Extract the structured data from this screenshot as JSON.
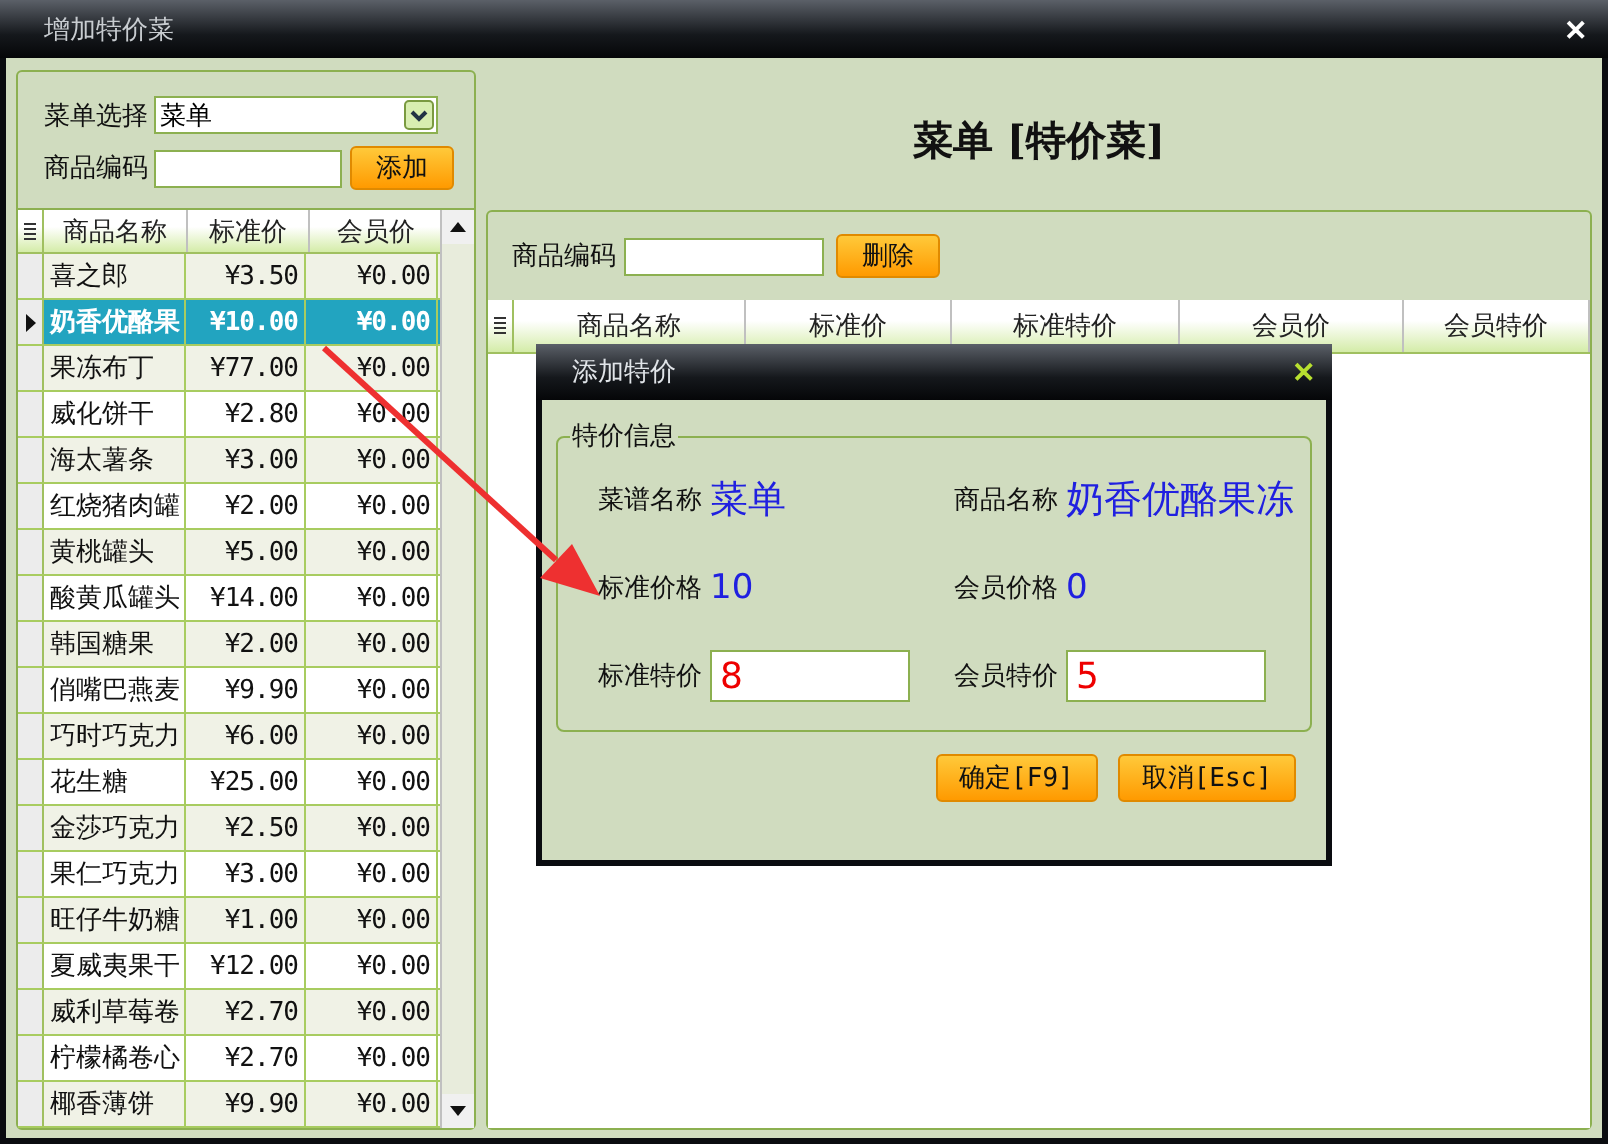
{
  "window": {
    "title": "增加特价菜",
    "close": "✕"
  },
  "left_panel": {
    "menu_select": {
      "label": "菜单选择",
      "value": "菜单"
    },
    "code_field": {
      "label": "商品编码"
    },
    "add_button": "添加"
  },
  "left_table": {
    "columns": [
      "商品名称",
      "标准价",
      "会员价"
    ],
    "rows": [
      {
        "name": "喜之郎",
        "price": "¥3.50",
        "member_price": "¥0.00",
        "selected": false
      },
      {
        "name": "奶香优酪果",
        "price": "¥10.00",
        "member_price": "¥0.00",
        "selected": true
      },
      {
        "name": "果冻布丁",
        "price": "¥77.00",
        "member_price": "¥0.00",
        "selected": false
      },
      {
        "name": "威化饼干",
        "price": "¥2.80",
        "member_price": "¥0.00",
        "selected": false
      },
      {
        "name": "海太薯条",
        "price": "¥3.00",
        "member_price": "¥0.00",
        "selected": false
      },
      {
        "name": "红烧猪肉罐",
        "price": "¥2.00",
        "member_price": "¥0.00",
        "selected": false
      },
      {
        "name": "黄桃罐头",
        "price": "¥5.00",
        "member_price": "¥0.00",
        "selected": false
      },
      {
        "name": "酸黄瓜罐头",
        "price": "¥14.00",
        "member_price": "¥0.00",
        "selected": false
      },
      {
        "name": "韩国糖果",
        "price": "¥2.00",
        "member_price": "¥0.00",
        "selected": false
      },
      {
        "name": "俏嘴巴燕麦",
        "price": "¥9.90",
        "member_price": "¥0.00",
        "selected": false
      },
      {
        "name": "巧时巧克力",
        "price": "¥6.00",
        "member_price": "¥0.00",
        "selected": false
      },
      {
        "name": "花生糖",
        "price": "¥25.00",
        "member_price": "¥0.00",
        "selected": false
      },
      {
        "name": "金莎巧克力",
        "price": "¥2.50",
        "member_price": "¥0.00",
        "selected": false
      },
      {
        "name": "果仁巧克力",
        "price": "¥3.00",
        "member_price": "¥0.00",
        "selected": false
      },
      {
        "name": "旺仔牛奶糖",
        "price": "¥1.00",
        "member_price": "¥0.00",
        "selected": false
      },
      {
        "name": "夏威夷果干",
        "price": "¥12.00",
        "member_price": "¥0.00",
        "selected": false
      },
      {
        "name": "威利草莓卷",
        "price": "¥2.70",
        "member_price": "¥0.00",
        "selected": false
      },
      {
        "name": "柠檬橘卷心",
        "price": "¥2.70",
        "member_price": "¥0.00",
        "selected": false
      },
      {
        "name": "椰香薄饼",
        "price": "¥9.90",
        "member_price": "¥0.00",
        "selected": false
      }
    ]
  },
  "right_panel": {
    "heading": "菜单 [特价菜]",
    "code_field": {
      "label": "商品编码"
    },
    "delete_button": "删除",
    "table": {
      "columns": [
        "商品名称",
        "标准价",
        "标准特价",
        "会员价",
        "会员特价"
      ]
    }
  },
  "dialog": {
    "title": "添加特价",
    "close": "✕",
    "group_title": "特价信息",
    "fields": [
      {
        "kind": "text",
        "label": "菜谱名称",
        "value": "菜单"
      },
      {
        "kind": "text",
        "label": "商品名称",
        "value": "奶香优酪果冻"
      },
      {
        "kind": "text",
        "label": "标准价格",
        "value": "10"
      },
      {
        "kind": "text",
        "label": "会员价格",
        "value": "0"
      },
      {
        "kind": "input",
        "label": "标准特价",
        "value": "8"
      },
      {
        "kind": "input",
        "label": "会员特价",
        "value": "5"
      }
    ],
    "buttons": [
      "确定[F9]",
      "取消[Esc]"
    ]
  }
}
